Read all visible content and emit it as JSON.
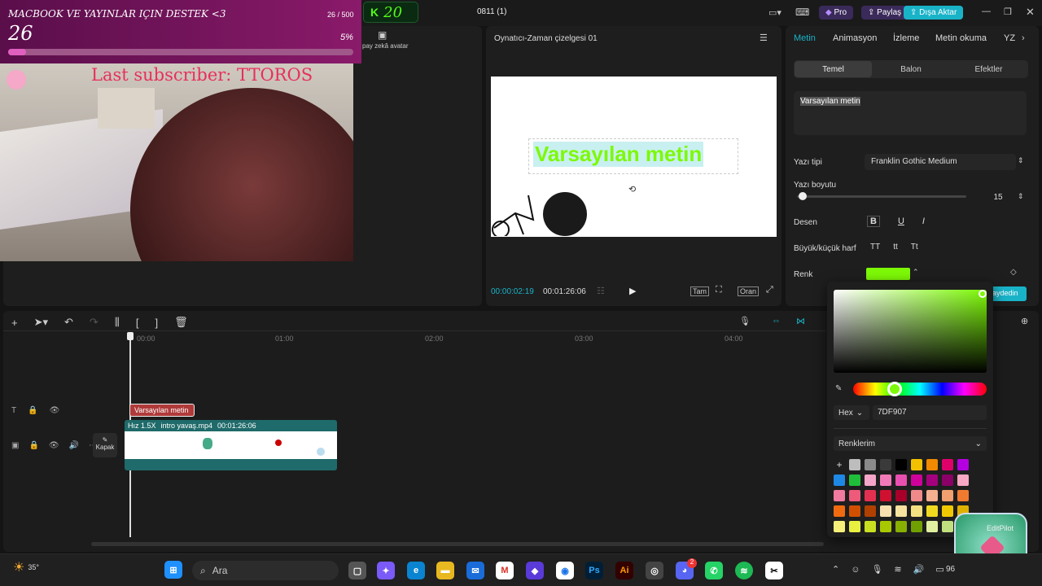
{
  "app": {
    "project_title": "0811 (1)"
  },
  "topbar": {
    "pro": "Pro",
    "share": "Paylaş",
    "export": "Dışa Aktar",
    "kick_count": "20"
  },
  "overlay": {
    "goal_title": "MACBOOK VE YAYINLAR IÇIN DESTEK <3",
    "goal_value": "26",
    "goal_count": "26 / 500",
    "goal_percent": "5%",
    "goal_progress": 0.052,
    "subscriber_text": "Last subscriber: TTOROS"
  },
  "left_panel": {
    "ai_avatar_label": "pay zekâ avatar"
  },
  "player": {
    "title": "Oynatıcı-Zaman çizelgesi 01",
    "preview_text": "Varsayılan metin",
    "current_time": "00:00:02:19",
    "total_time": "00:01:26:06",
    "full_btn": "Tam",
    "ratio_btn": "Oran"
  },
  "right_panel": {
    "tabs": [
      "Metin",
      "Animasyon",
      "İzleme",
      "Metin okuma",
      "YZ"
    ],
    "subtabs": [
      "Temel",
      "Balon",
      "Efektler"
    ],
    "text_value": "Varsayılan metin",
    "font_label": "Yazı tipi",
    "font_value": "Franklin Gothic Medium",
    "size_label": "Yazı boyutu",
    "size_value": "15",
    "pattern_label": "Desen",
    "case_label": "Büyük/küçük harf",
    "case_options": [
      "TT",
      "tt",
      "Tt"
    ],
    "color_label": "Renk",
    "color_value": "#7DF907",
    "save_label": "aydedin"
  },
  "color_picker": {
    "format": "Hex",
    "hex_value": "7DF907",
    "palette_title": "Renklerim",
    "swatches": [
      [
        "#ffffff",
        "#bdbdbd",
        "#8a8a8a",
        "#3a3a3a",
        "#000000",
        "#f2c200",
        "#f08a00",
        "#e0006a",
        "#b400e0"
      ],
      [
        "#1e88e5",
        "#1fbf3a",
        "#f5a6c8",
        "#f07ab8",
        "#e94fb0",
        "#d0009a",
        "#a4007e",
        "#8a0066",
        "#f7a7c3"
      ],
      [
        "#f07aa0",
        "#ee5a7a",
        "#e33050",
        "#d01030",
        "#a8002a",
        "#f08a8a",
        "#f4b090",
        "#f2a070",
        "#f07a30"
      ],
      [
        "#f06a10",
        "#d05000",
        "#b04000",
        "#f8e0b0",
        "#f6e3a0",
        "#f3e080",
        "#f0da20",
        "#f0c800",
        "#e0b000"
      ],
      [
        "#f6f07a",
        "#e8f040",
        "#c8e020",
        "#a8c800",
        "#88b000",
        "#70a000",
        "#e0f0a0",
        "#c0e080",
        "#a0d060"
      ]
    ]
  },
  "timeline": {
    "ticks": [
      "00:00",
      "01:00",
      "02:00",
      "03:00",
      "04:00"
    ],
    "text_clip": "Varsayılan metin",
    "video_clip_speed": "Hız 1.5X",
    "video_clip_name": "intro yavaş.mp4",
    "video_clip_duration": "00:01:26:06",
    "cover_label": "Kapak"
  },
  "editpilot": {
    "label": "EditPilot"
  },
  "taskbar": {
    "weather_temp": "35°",
    "search_text": "Ara",
    "battery": "96",
    "discord_badge": "2"
  }
}
